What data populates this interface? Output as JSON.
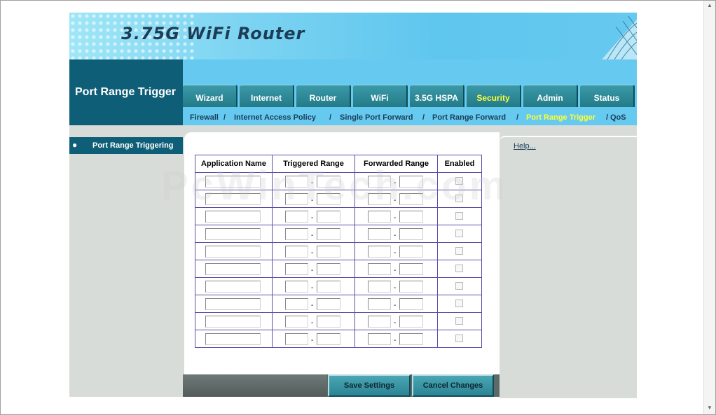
{
  "header": {
    "title": "3.75G WiFi Router"
  },
  "section": {
    "title": "Port Range Trigger"
  },
  "tabs": [
    {
      "label": "Wizard",
      "active": false
    },
    {
      "label": "Internet",
      "active": false
    },
    {
      "label": "Router",
      "active": false
    },
    {
      "label": "WiFi",
      "active": false
    },
    {
      "label": "3.5G HSPA",
      "active": false
    },
    {
      "label": "Security",
      "active": true
    },
    {
      "label": "Admin",
      "active": false
    },
    {
      "label": "Status",
      "active": false
    }
  ],
  "subnav": [
    {
      "label": "Firewall",
      "active": false
    },
    {
      "label": "Internet Access Policy",
      "active": false
    },
    {
      "label": "Single Port Forward",
      "active": false
    },
    {
      "label": "Port Range Forward",
      "active": false
    },
    {
      "label": "Port Range Trigger",
      "active": true
    },
    {
      "label": "QoS",
      "active": false
    }
  ],
  "subnav_separator": "/",
  "left_menu": {
    "bullet": "●",
    "label": "Port Range Triggering"
  },
  "help": {
    "label": "Help..."
  },
  "table": {
    "headers": [
      "Application Name",
      "Triggered Range",
      "Forwarded Range",
      "Enabled"
    ],
    "range_separator": "-",
    "rows": [
      {
        "app": "",
        "trig_start": "",
        "trig_end": "",
        "fwd_start": "",
        "fwd_end": "",
        "enabled": false
      },
      {
        "app": "",
        "trig_start": "",
        "trig_end": "",
        "fwd_start": "",
        "fwd_end": "",
        "enabled": false
      },
      {
        "app": "",
        "trig_start": "",
        "trig_end": "",
        "fwd_start": "",
        "fwd_end": "",
        "enabled": false
      },
      {
        "app": "",
        "trig_start": "",
        "trig_end": "",
        "fwd_start": "",
        "fwd_end": "",
        "enabled": false
      },
      {
        "app": "",
        "trig_start": "",
        "trig_end": "",
        "fwd_start": "",
        "fwd_end": "",
        "enabled": false
      },
      {
        "app": "",
        "trig_start": "",
        "trig_end": "",
        "fwd_start": "",
        "fwd_end": "",
        "enabled": false
      },
      {
        "app": "",
        "trig_start": "",
        "trig_end": "",
        "fwd_start": "",
        "fwd_end": "",
        "enabled": false
      },
      {
        "app": "",
        "trig_start": "",
        "trig_end": "",
        "fwd_start": "",
        "fwd_end": "",
        "enabled": false
      },
      {
        "app": "",
        "trig_start": "",
        "trig_end": "",
        "fwd_start": "",
        "fwd_end": "",
        "enabled": false
      },
      {
        "app": "",
        "trig_start": "",
        "trig_end": "",
        "fwd_start": "",
        "fwd_end": "",
        "enabled": false
      }
    ]
  },
  "buttons": {
    "save": "Save Settings",
    "cancel": "Cancel Changes"
  },
  "watermark": {
    "text": "PcWinTech.com"
  },
  "colors": {
    "accent": "#0f5e78",
    "nav_bg": "#66c9f0",
    "active_text": "#ffff33",
    "panel_bg": "#d8dcd8",
    "table_border": "#5d4ea6"
  }
}
